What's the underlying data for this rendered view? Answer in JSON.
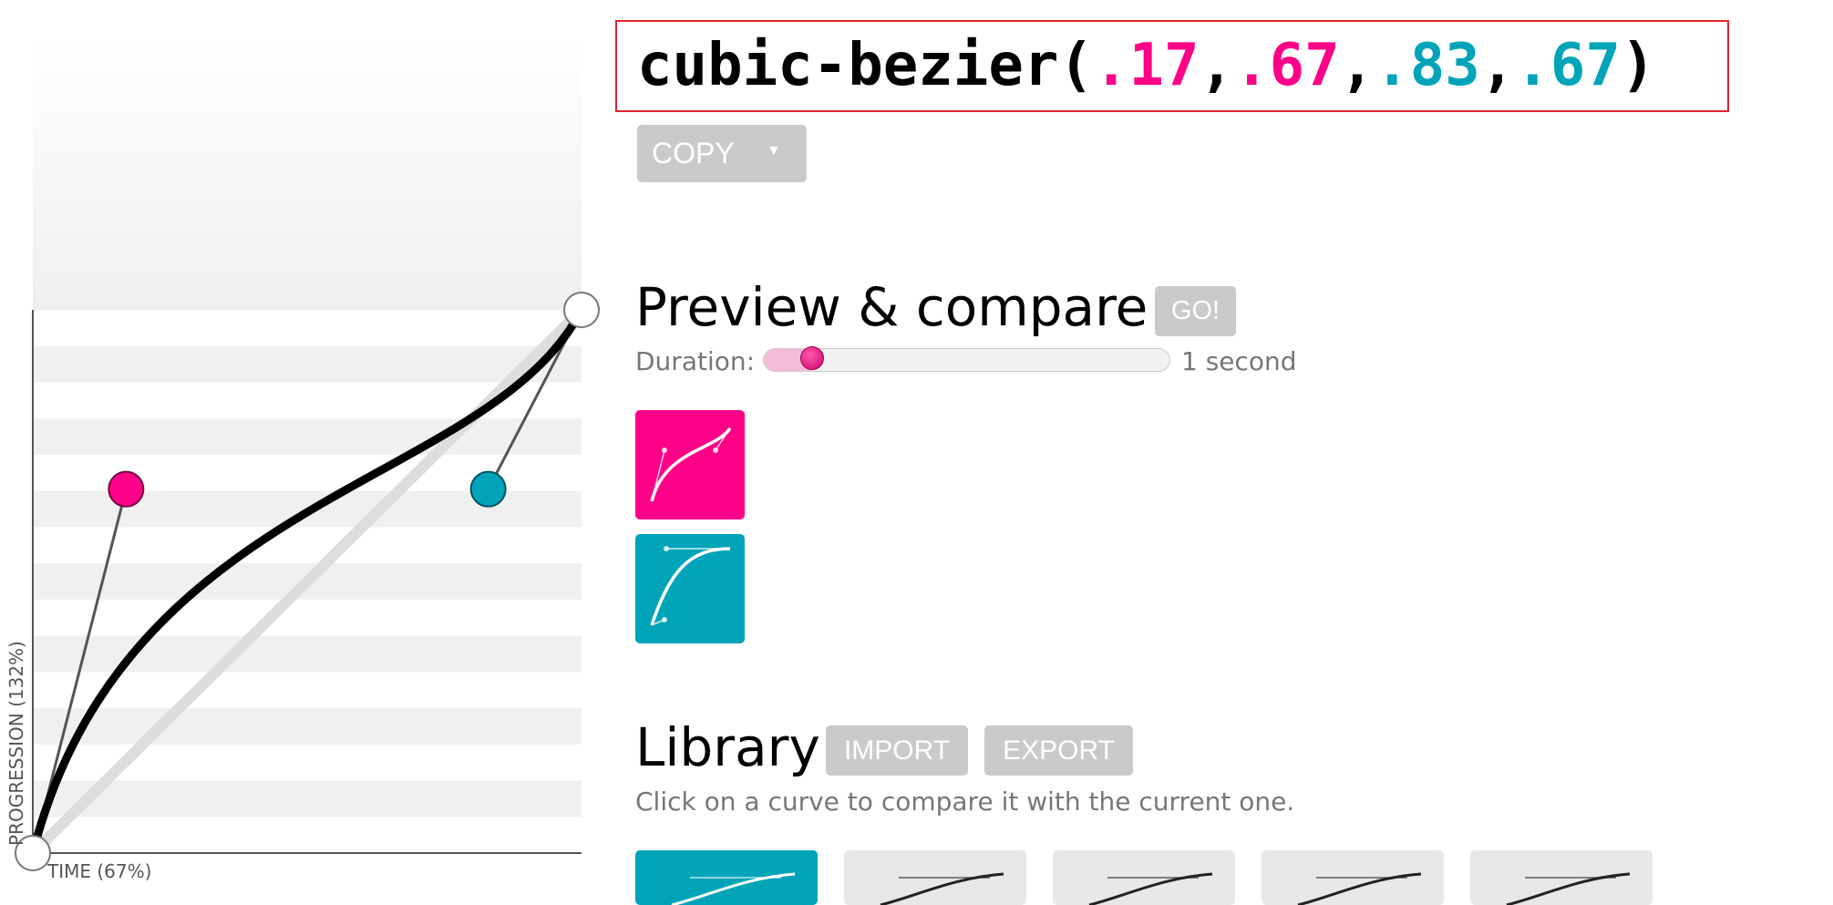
{
  "curve": {
    "x1": 0.17,
    "y1": 0.67,
    "x2": 0.83,
    "y2": 0.67,
    "colors": {
      "p1": "#ff0088",
      "p2": "#00a4b8",
      "curve": "#000000",
      "stripe": "#f0f0f0"
    }
  },
  "axes": {
    "time_label": "TIME (67%)",
    "progression_label": "PROGRESSION (132%)"
  },
  "output": {
    "prefix": "cubic-bezier(",
    "x1": ".17",
    "y1": ".67",
    "x2": ".83",
    "y2": ".67",
    "sep": ",",
    "suffix": ")"
  },
  "copy": {
    "label": "COPY",
    "caret": "▼"
  },
  "preview": {
    "title": "Preview & compare",
    "go_label": "GO!",
    "duration_label": "Duration:",
    "duration_value": "1 second",
    "duration_fraction": 0.12
  },
  "library": {
    "title": "Library",
    "import_label": "IMPORT",
    "export_label": "EXPORT",
    "hint": "Click on a curve to compare it with the current one.",
    "items": [
      {
        "id": "item-1",
        "active": true
      },
      {
        "id": "item-2",
        "active": false
      },
      {
        "id": "item-3",
        "active": false
      },
      {
        "id": "item-4",
        "active": false
      },
      {
        "id": "item-5",
        "active": false
      }
    ]
  }
}
